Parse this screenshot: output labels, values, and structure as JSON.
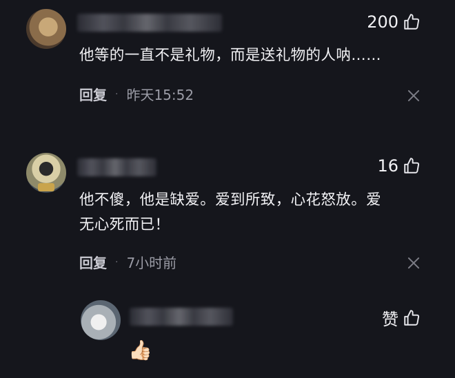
{
  "comments": [
    {
      "likes": "200",
      "text": "他等的一直不是礼物，而是送礼物的人呐……",
      "reply_label": "回复",
      "separator": "·",
      "time": "昨天15:52"
    },
    {
      "likes": "16",
      "text_line1": "他不傻，他是缺爱。爱到所致，心花怒放。爱",
      "text_line2": "无心死而已！",
      "reply_label": "回复",
      "separator": "·",
      "time": "7小时前"
    }
  ],
  "reply": {
    "like_label": "赞",
    "emoji": "👍🏻"
  },
  "colors": {
    "background": "#15161c",
    "text": "#f1f1f4",
    "meta": "#9b9ca6"
  },
  "icons": [
    "thumb-up-icon",
    "close-icon",
    "thumbs-up-emoji"
  ]
}
